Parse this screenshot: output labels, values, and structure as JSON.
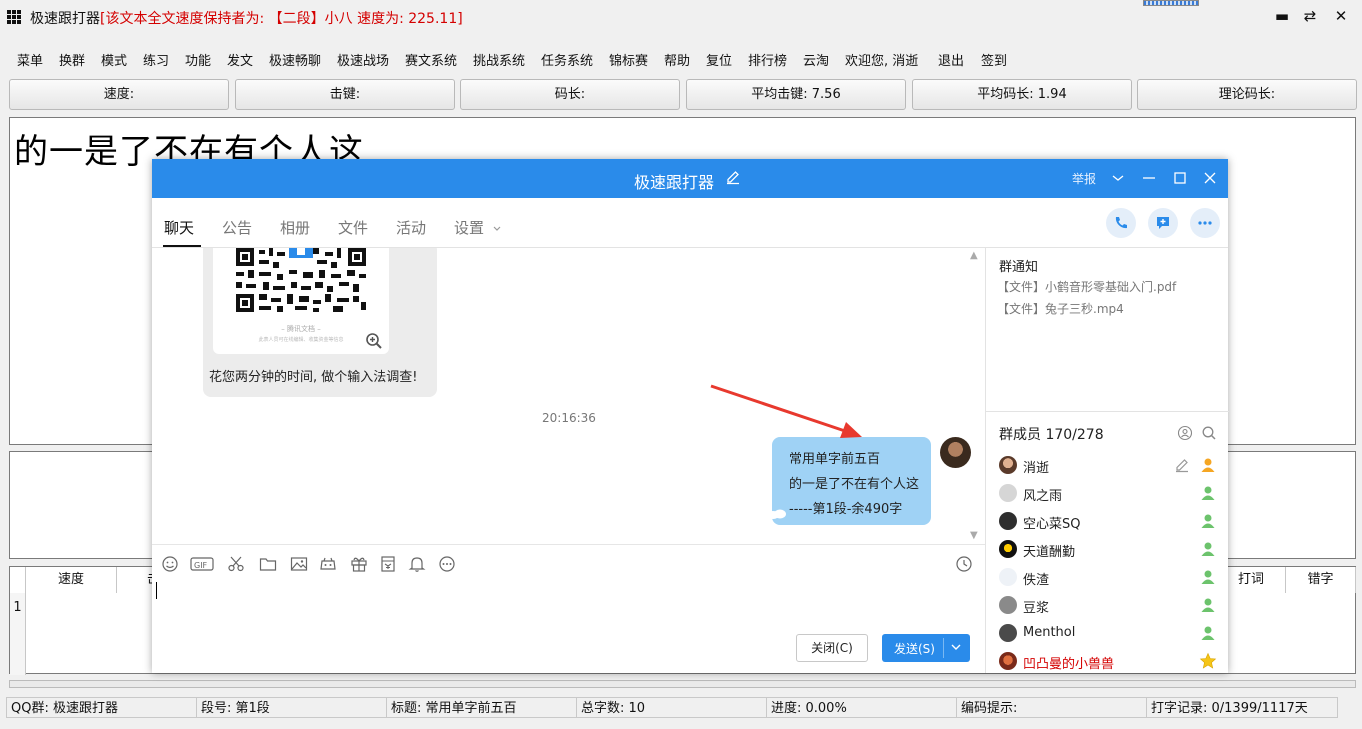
{
  "app": {
    "title_main": "极速跟打器",
    "title_info": "[该文本全文速度保持者为: 【二段】小八 速度为: 225.11]",
    "win_controls": {
      "minimize": "▬",
      "restore": "⇄",
      "close": "✕"
    }
  },
  "menu": [
    "菜单",
    "换群",
    "模式",
    "练习",
    "功能",
    "发文",
    "极速畅聊",
    "极速战场",
    "赛文系统",
    "挑战系统",
    "任务系统",
    "锦标赛",
    "帮助",
    "复位",
    "排行榜",
    "云淘",
    "欢迎您, 消逝",
    "退出",
    "签到"
  ],
  "stats": [
    "速度:",
    "击键:",
    "码长:",
    "平均击键: 7.56",
    "平均码长: 1.94",
    "理论码长:"
  ],
  "text_display": "的一是了不在有个人这",
  "grid": {
    "headers": [
      "速度",
      "击",
      "打词",
      "错字"
    ],
    "row_number": "1"
  },
  "statusbar": [
    "QQ群: 极速跟打器",
    "段号: 第1段",
    "标题: 常用单字前五百",
    "总字数: 10",
    "进度: 0.00%",
    "编码提示:",
    "打字记录: 0/1399/1117天"
  ],
  "chat": {
    "title": "极速跟打器",
    "report": "举报",
    "tabs": [
      "聊天",
      "公告",
      "相册",
      "文件",
      "活动",
      "设置"
    ],
    "qr_caption": "花您两分钟的时间, 做个输入法调查!",
    "qr_sub": "– 腾讯文档 –",
    "qr_sub2": "此表人员可在线编辑、收集资金等信息",
    "timestamp": "20:16:36",
    "message_lines": [
      "常用单字前五百",
      "的一是了不在有个人这",
      "-----第1段-余490字"
    ],
    "close_label": "关闭(C)",
    "send_label": "发送(S)",
    "notice": {
      "title": "群通知",
      "items": [
        "【文件】小鹤音形零基础入门.pdf",
        "【文件】兔子三秒.mp4"
      ]
    },
    "members_title": "群成员 170/278",
    "members": [
      {
        "name": "消逝",
        "role": "admin",
        "highlight": false
      },
      {
        "name": "风之雨",
        "role": "member",
        "highlight": false
      },
      {
        "name": "空心菜SQ",
        "role": "member",
        "highlight": false
      },
      {
        "name": "天道酬勤",
        "role": "member",
        "highlight": false
      },
      {
        "name": "佚渣",
        "role": "member",
        "highlight": false
      },
      {
        "name": "豆浆",
        "role": "member",
        "highlight": false
      },
      {
        "name": "Menthol",
        "role": "member",
        "highlight": false
      },
      {
        "name": "凹凸曼的小兽兽",
        "role": "owner",
        "highlight": true
      }
    ]
  },
  "colors": {
    "accent": "#2a8bea",
    "bubble": "#9fd2f5",
    "red_text": "#d40000",
    "annotation_arrow": "#e8392e"
  }
}
